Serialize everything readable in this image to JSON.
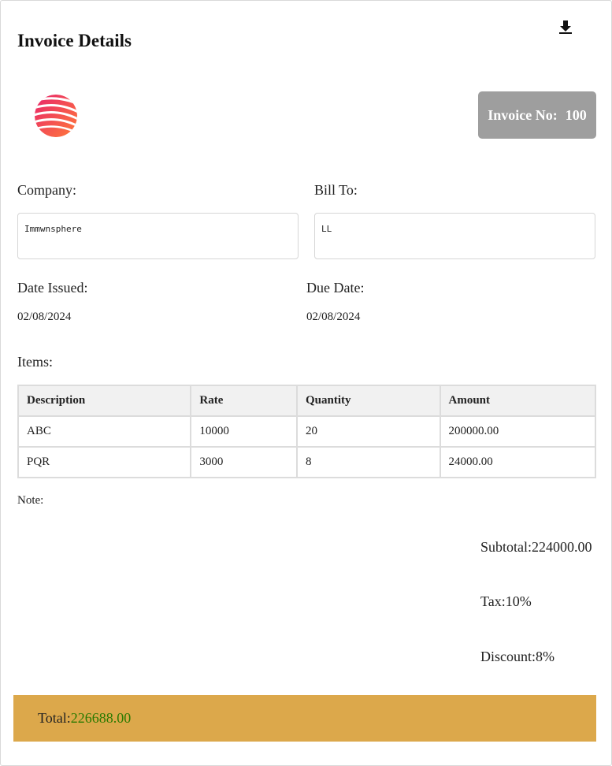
{
  "header": {
    "title": "Invoice Details",
    "download_icon": "download-icon"
  },
  "invoice": {
    "number_label": "Invoice No:",
    "number_value": "100"
  },
  "company": {
    "label": "Company:",
    "value": "Immwnsphere"
  },
  "bill_to": {
    "label": "Bill To:",
    "value": "LL"
  },
  "dates": {
    "issued_label": "Date Issued:",
    "issued_value": "02/08/2024",
    "due_label": "Due Date:",
    "due_value": "02/08/2024"
  },
  "items": {
    "label": "Items:",
    "columns": [
      "Description",
      "Rate",
      "Quantity",
      "Amount"
    ],
    "rows": [
      [
        "ABC",
        "10000",
        "20",
        "200000.00"
      ],
      [
        "PQR",
        "3000",
        "8",
        "24000.00"
      ]
    ]
  },
  "note": {
    "label": "Note:"
  },
  "summary": {
    "subtotal_label": "Subtotal:",
    "subtotal_value": "224000.00",
    "tax_label": "Tax:",
    "tax_value": "10%",
    "discount_label": "Discount:",
    "discount_value": "8%"
  },
  "total": {
    "label": "Total:",
    "value": "226688.00"
  },
  "colors": {
    "invoice_badge": "#9e9e9e",
    "total_bar": "#dca84b",
    "total_value": "#2a7a00"
  }
}
